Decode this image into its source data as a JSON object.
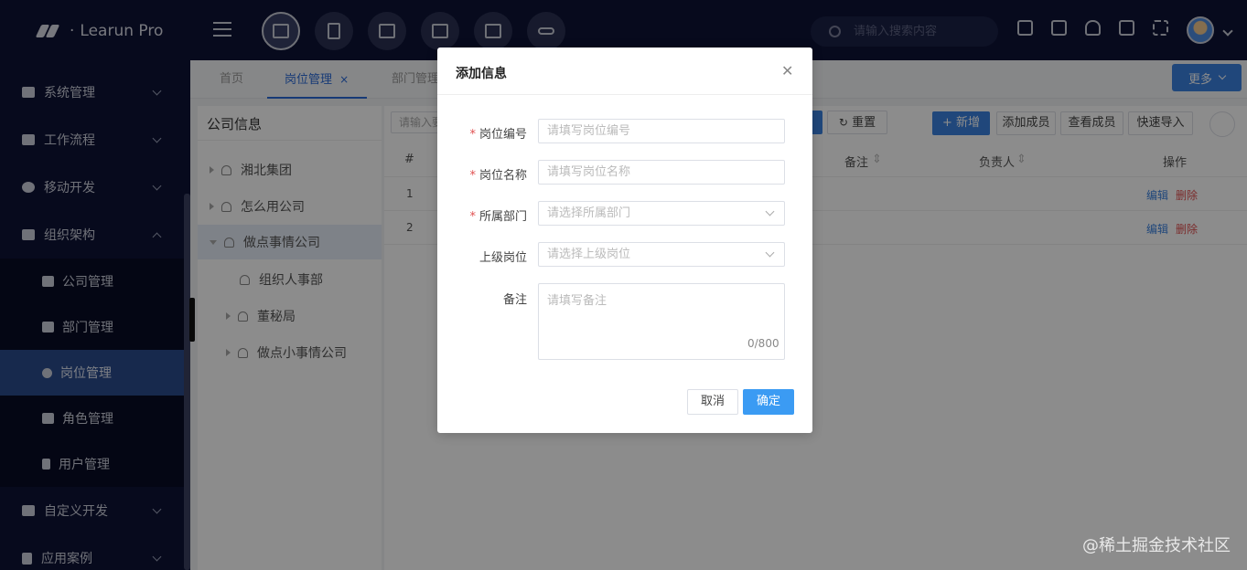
{
  "app": {
    "title": "Learun Pro"
  },
  "header": {
    "search_placeholder": "请输入搜索内容",
    "nav_icons": [
      "code-window-icon",
      "document-icon",
      "monitor-icon",
      "list-window-icon",
      "chart-window-icon",
      "sliders-icon"
    ],
    "right_icons": [
      "lock-icon",
      "shirt-icon",
      "bell-icon",
      "translate-icon",
      "fullscreen-icon"
    ]
  },
  "sidebar": {
    "items": [
      {
        "label": "系统管理",
        "icon": "monitor-icon"
      },
      {
        "label": "工作流程",
        "icon": "share-icon"
      },
      {
        "label": "移动开发",
        "icon": "github-icon"
      },
      {
        "label": "组织架构",
        "icon": "sitemap-icon",
        "expanded": true
      },
      {
        "label": "自定义开发",
        "icon": "bath-icon"
      },
      {
        "label": "应用案例",
        "icon": "file-icon"
      }
    ],
    "sub_items": [
      {
        "label": "公司管理",
        "icon": "bank-icon"
      },
      {
        "label": "部门管理",
        "icon": "list-icon"
      },
      {
        "label": "岗位管理",
        "icon": "gear-icon",
        "active": true
      },
      {
        "label": "角色管理",
        "icon": "users-icon"
      },
      {
        "label": "用户管理",
        "icon": "user-icon"
      }
    ]
  },
  "tabs": [
    {
      "label": "首页"
    },
    {
      "label": "岗位管理",
      "closable": "×",
      "active": true
    },
    {
      "label": "部门管理"
    }
  ],
  "more_button": {
    "label": "更多"
  },
  "tree": {
    "title": "公司信息",
    "nodes": [
      {
        "label": "湘北集团"
      },
      {
        "label": "怎么用公司"
      },
      {
        "label": "做点事情公司"
      },
      {
        "label": "组织人事部"
      },
      {
        "label": "董秘局"
      },
      {
        "label": "做点小事情公司"
      }
    ]
  },
  "toolbar": {
    "search_placeholder": "请输入要",
    "reset": "重置",
    "add": "+ 新增",
    "add_member": "添加成员",
    "view_member": "查看成员",
    "quick_import": "快速导入"
  },
  "table": {
    "columns": {
      "index": "#",
      "remark": "备注",
      "owner": "负责人",
      "actions": "操作"
    },
    "rows": [
      {
        "index": "1",
        "edit": "编辑",
        "delete": "删除"
      },
      {
        "index": "2",
        "edit": "编辑",
        "delete": "删除"
      }
    ]
  },
  "modal": {
    "title": "添加信息",
    "fields": {
      "code": {
        "label": "岗位编号",
        "placeholder": "请填写岗位编号",
        "required": "*"
      },
      "name": {
        "label": "岗位名称",
        "placeholder": "请填写岗位名称",
        "required": "*"
      },
      "department": {
        "label": "所属部门",
        "placeholder": "请选择所属部门",
        "required": "*"
      },
      "parent": {
        "label": "上级岗位",
        "placeholder": "请选择上级岗位"
      },
      "remark": {
        "label": "备注",
        "placeholder": "请填写备注",
        "counter": "0/800"
      }
    },
    "cancel": "取消",
    "ok": "确定"
  },
  "watermark": "@稀土掘金技术社区"
}
